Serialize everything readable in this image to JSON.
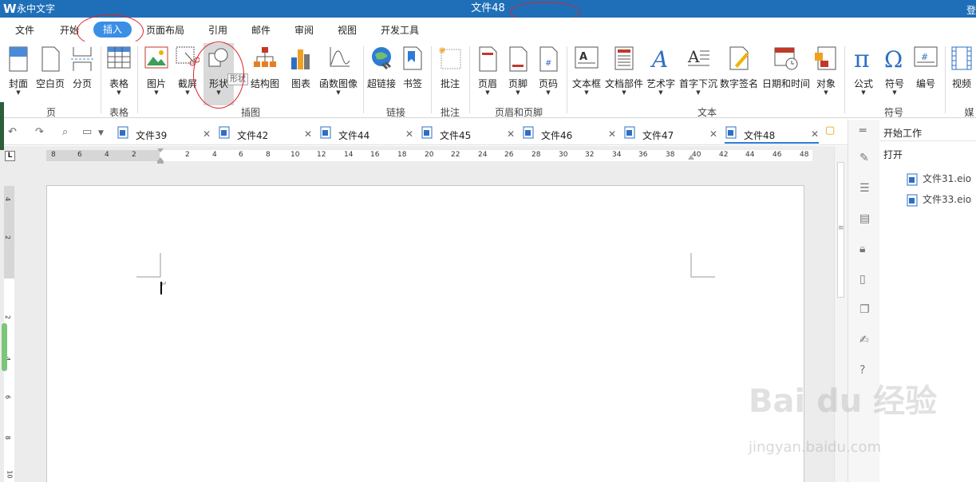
{
  "titlebar": {
    "logo": "W",
    "app_name": "永中文字",
    "doc_title": "文件48",
    "right_stub": "登"
  },
  "menu": {
    "tabs": [
      "文件",
      "开始",
      "插入",
      "页面布局",
      "引用",
      "邮件",
      "审阅",
      "视图",
      "开发工具"
    ],
    "active": "插入"
  },
  "ribbon": {
    "buttons": {
      "cover": "封面",
      "blank_page": "空白页",
      "page_break": "分页",
      "table": "表格",
      "picture": "图片",
      "screenshot": "截屏",
      "shape": "形状",
      "smartart": "结构图",
      "chart": "图表",
      "func_image": "函数图像",
      "hyperlink": "超链接",
      "bookmark": "书签",
      "comment": "批注",
      "header": "页眉",
      "footer": "页脚",
      "page_num": "页码",
      "textbox": "文本框",
      "docpart": "文档部件",
      "wordart": "艺术字",
      "dropcap": "首字下沉",
      "signature": "数字签名",
      "datetime": "日期和时间",
      "object": "对象",
      "formula": "公式",
      "symbol": "符号",
      "numbering": "编号",
      "video": "视频"
    },
    "groups": {
      "page": "页",
      "table": "表格",
      "illustration": "插图",
      "link": "链接",
      "comment": "批注",
      "header_footer": "页眉和页脚",
      "text": "文本",
      "symbol": "符号",
      "media": "媒"
    },
    "tooltip": "形状"
  },
  "doc_tabs": [
    {
      "label": "文件39"
    },
    {
      "label": "文件42"
    },
    {
      "label": "文件44"
    },
    {
      "label": "文件45"
    },
    {
      "label": "文件46"
    },
    {
      "label": "文件47"
    },
    {
      "label": "文件48"
    }
  ],
  "active_tab": "文件48",
  "ruler": {
    "corner": "L",
    "numbers": [
      "8",
      "6",
      "4",
      "2",
      "2",
      "4",
      "6",
      "8",
      "10",
      "12",
      "14",
      "16",
      "18",
      "20",
      "22",
      "24",
      "26",
      "28",
      "30",
      "32",
      "34",
      "36",
      "38",
      "40",
      "42",
      "44",
      "46",
      "48"
    ],
    "vnumbers": [
      "4",
      "2",
      "2",
      "4",
      "6",
      "8",
      "10"
    ]
  },
  "side_panel": {
    "title": "开始工作",
    "open_label": "打开",
    "recent_files": [
      "文件31.eio",
      "文件33.eio"
    ]
  },
  "watermark": {
    "line1": "Bai du 经验",
    "line2": "jingyan.baidu.com"
  },
  "colors": {
    "titlebar": "#1f6fb8",
    "active_tab": "#3a8ee6",
    "annotation": "#d9232c"
  }
}
